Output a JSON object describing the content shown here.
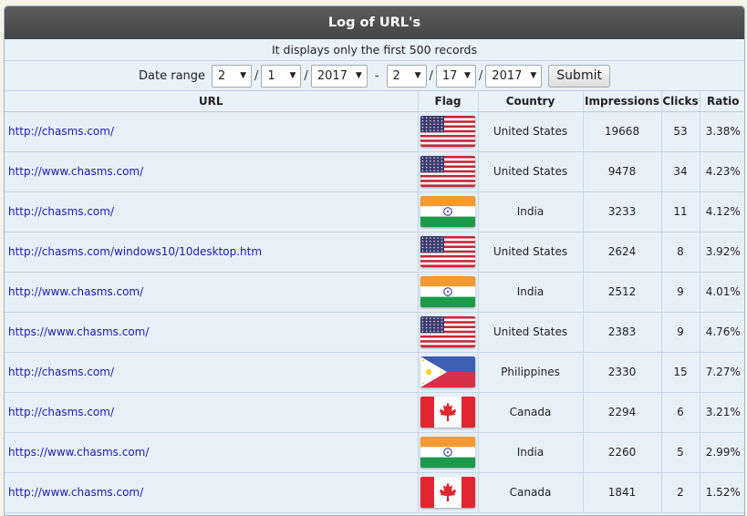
{
  "header": {
    "title": "Log of URL's"
  },
  "notice": "It displays only the first 500 records",
  "filter": {
    "label": "Date range",
    "from_month": "2",
    "from_day": "1",
    "from_year": "2017",
    "to_month": "2",
    "to_day": "17",
    "to_year": "2017",
    "sep_slash": "/",
    "sep_dash": "-",
    "dropdown_arrow": "▼",
    "submit_label": "Submit"
  },
  "table": {
    "columns": [
      "URL",
      "Flag",
      "Country",
      "Impressions",
      "Clicks",
      "Ratio"
    ],
    "rows": [
      {
        "url": "http://chasms.com/",
        "flag": "us",
        "country": "United States",
        "impressions": "19668",
        "clicks": "53",
        "ratio": "3.38%"
      },
      {
        "url": "http://www.chasms.com/",
        "flag": "us",
        "country": "United States",
        "impressions": "9478",
        "clicks": "34",
        "ratio": "4.23%"
      },
      {
        "url": "http://chasms.com/",
        "flag": "in",
        "country": "India",
        "impressions": "3233",
        "clicks": "11",
        "ratio": "4.12%"
      },
      {
        "url": "http://chasms.com/windows10/10desktop.htm",
        "flag": "us",
        "country": "United States",
        "impressions": "2624",
        "clicks": "8",
        "ratio": "3.92%"
      },
      {
        "url": "http://www.chasms.com/",
        "flag": "in",
        "country": "India",
        "impressions": "2512",
        "clicks": "9",
        "ratio": "4.01%"
      },
      {
        "url": "https://www.chasms.com/",
        "flag": "us",
        "country": "United States",
        "impressions": "2383",
        "clicks": "9",
        "ratio": "4.76%"
      },
      {
        "url": "http://chasms.com/",
        "flag": "ph",
        "country": "Philippines",
        "impressions": "2330",
        "clicks": "15",
        "ratio": "7.27%"
      },
      {
        "url": "http://chasms.com/",
        "flag": "ca",
        "country": "Canada",
        "impressions": "2294",
        "clicks": "6",
        "ratio": "3.21%"
      },
      {
        "url": "https://www.chasms.com/",
        "flag": "in",
        "country": "India",
        "impressions": "2260",
        "clicks": "5",
        "ratio": "2.99%"
      },
      {
        "url": "http://www.chasms.com/",
        "flag": "ca",
        "country": "Canada",
        "impressions": "1841",
        "clicks": "2",
        "ratio": "1.52%"
      }
    ]
  },
  "colors": {
    "header_bg": "#4d4d4d",
    "panel_bg": "#e7f0f9",
    "link": "#1b1baa",
    "border": "#c6d6e6"
  }
}
